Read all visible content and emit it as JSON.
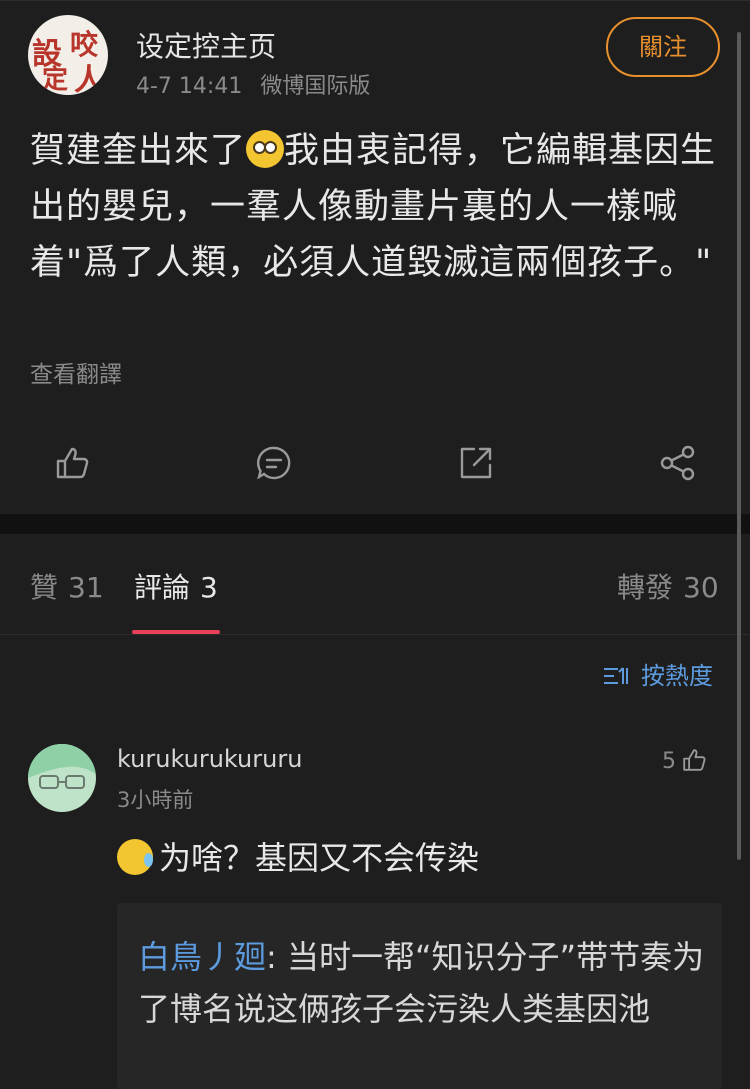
{
  "post": {
    "username": "设定控主页",
    "time": "4-7 14:41",
    "source": "微博国际版",
    "follow_label": "關注",
    "text_before_emoji": "賀建奎出來了",
    "text_after_emoji": "我由衷記得，它編輯基因生出的嬰兒，一羣人像動畫片裏的人一樣喊着\"爲了人類，必須人道毀滅這兩個孩子。\"",
    "translate_label": "查看翻譯",
    "avatar_chars": [
      "設",
      "定",
      "咬",
      "人"
    ]
  },
  "tabs": [
    {
      "label": "贊",
      "count": "31"
    },
    {
      "label": "評論",
      "count": "3"
    },
    {
      "label": "轉發",
      "count": "30"
    }
  ],
  "sort_label": "按熱度",
  "comment": {
    "username": "kurukurukururu",
    "time": "3小時前",
    "likes": "5",
    "text": "为啥？基因又不会传染",
    "reply_author": "白鳥丿廻",
    "reply_text": ": 当时一帮“知识分子”带节奏为了博名说这俩孩子会污染人类基因池"
  },
  "colors": {
    "background": "#1e1e1e",
    "accent_orange": "#e8902d",
    "link_blue": "#5d9bdf",
    "tab_underline": "#e8415b"
  }
}
